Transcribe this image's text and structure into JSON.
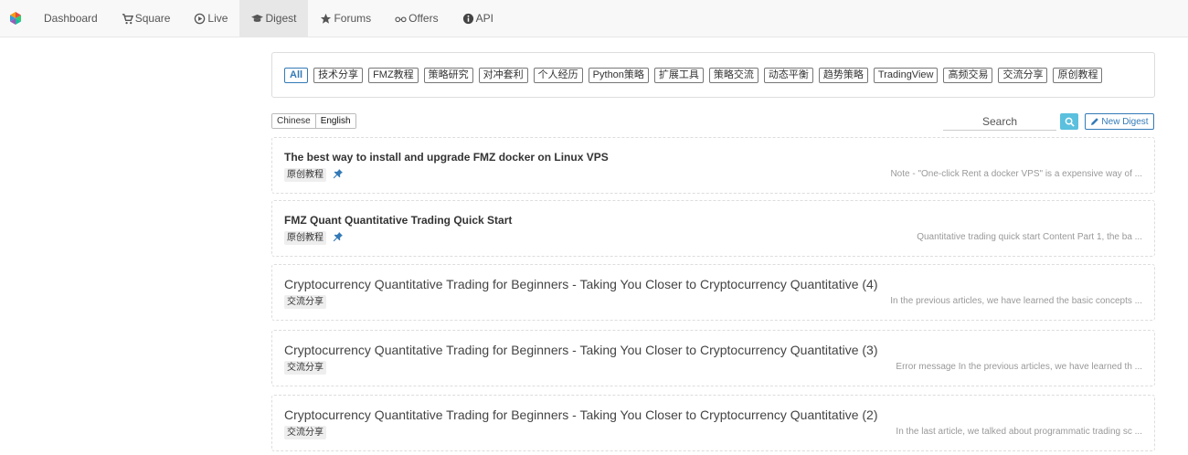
{
  "nav": {
    "items": [
      {
        "label": "Dashboard",
        "icon": "none"
      },
      {
        "label": "Square",
        "icon": "cart-icon"
      },
      {
        "label": "Live",
        "icon": "play-circle-icon"
      },
      {
        "label": "Digest",
        "icon": "graduation-cap-icon"
      },
      {
        "label": "Forums",
        "icon": "star-icon"
      },
      {
        "label": "Offers",
        "icon": "glasses-icon"
      },
      {
        "label": "API",
        "icon": "info-icon"
      }
    ],
    "active": "Digest"
  },
  "tags": [
    "All",
    "技术分享",
    "FMZ教程",
    "策略研究",
    "对冲套利",
    "个人经历",
    "Python策略",
    "扩展工具",
    "策略交流",
    "动态平衡",
    "趋势策略",
    "TradingView",
    "高频交易",
    "交流分享",
    "原创教程"
  ],
  "lang": {
    "chinese": "Chinese",
    "english": "English"
  },
  "search": {
    "placeholder": "Search"
  },
  "new_digest": {
    "label": "New Digest"
  },
  "posts": [
    {
      "title": "The best way to install and upgrade FMZ docker on Linux VPS",
      "tag": "原创教程",
      "excerpt": "Note - \"One-click Rent a docker VPS\" is a expensive way of ..."
    },
    {
      "title": "FMZ Quant Quantitative Trading Quick Start",
      "tag": "原创教程",
      "excerpt": "Quantitative trading quick start Content Part 1, the ba ..."
    },
    {
      "title": "Cryptocurrency Quantitative Trading for Beginners - Taking You Closer to Cryptocurrency Quantitative (4)",
      "tag": "交流分享",
      "excerpt": "In the previous articles, we have learned the basic concepts ..."
    },
    {
      "title": "Cryptocurrency Quantitative Trading for Beginners - Taking You Closer to Cryptocurrency Quantitative (3)",
      "tag": "交流分享",
      "excerpt": "Error message In the previous articles, we have learned th ..."
    },
    {
      "title": "Cryptocurrency Quantitative Trading for Beginners - Taking You Closer to Cryptocurrency Quantitative (2)",
      "tag": "交流分享",
      "excerpt": "In the last article, we talked about programmatic trading sc ..."
    }
  ],
  "colors": {
    "accent": "#337ab7",
    "search_button": "#5bc0de",
    "nav_bg": "#f8f8f8",
    "active_nav_bg": "#e7e7e7"
  }
}
